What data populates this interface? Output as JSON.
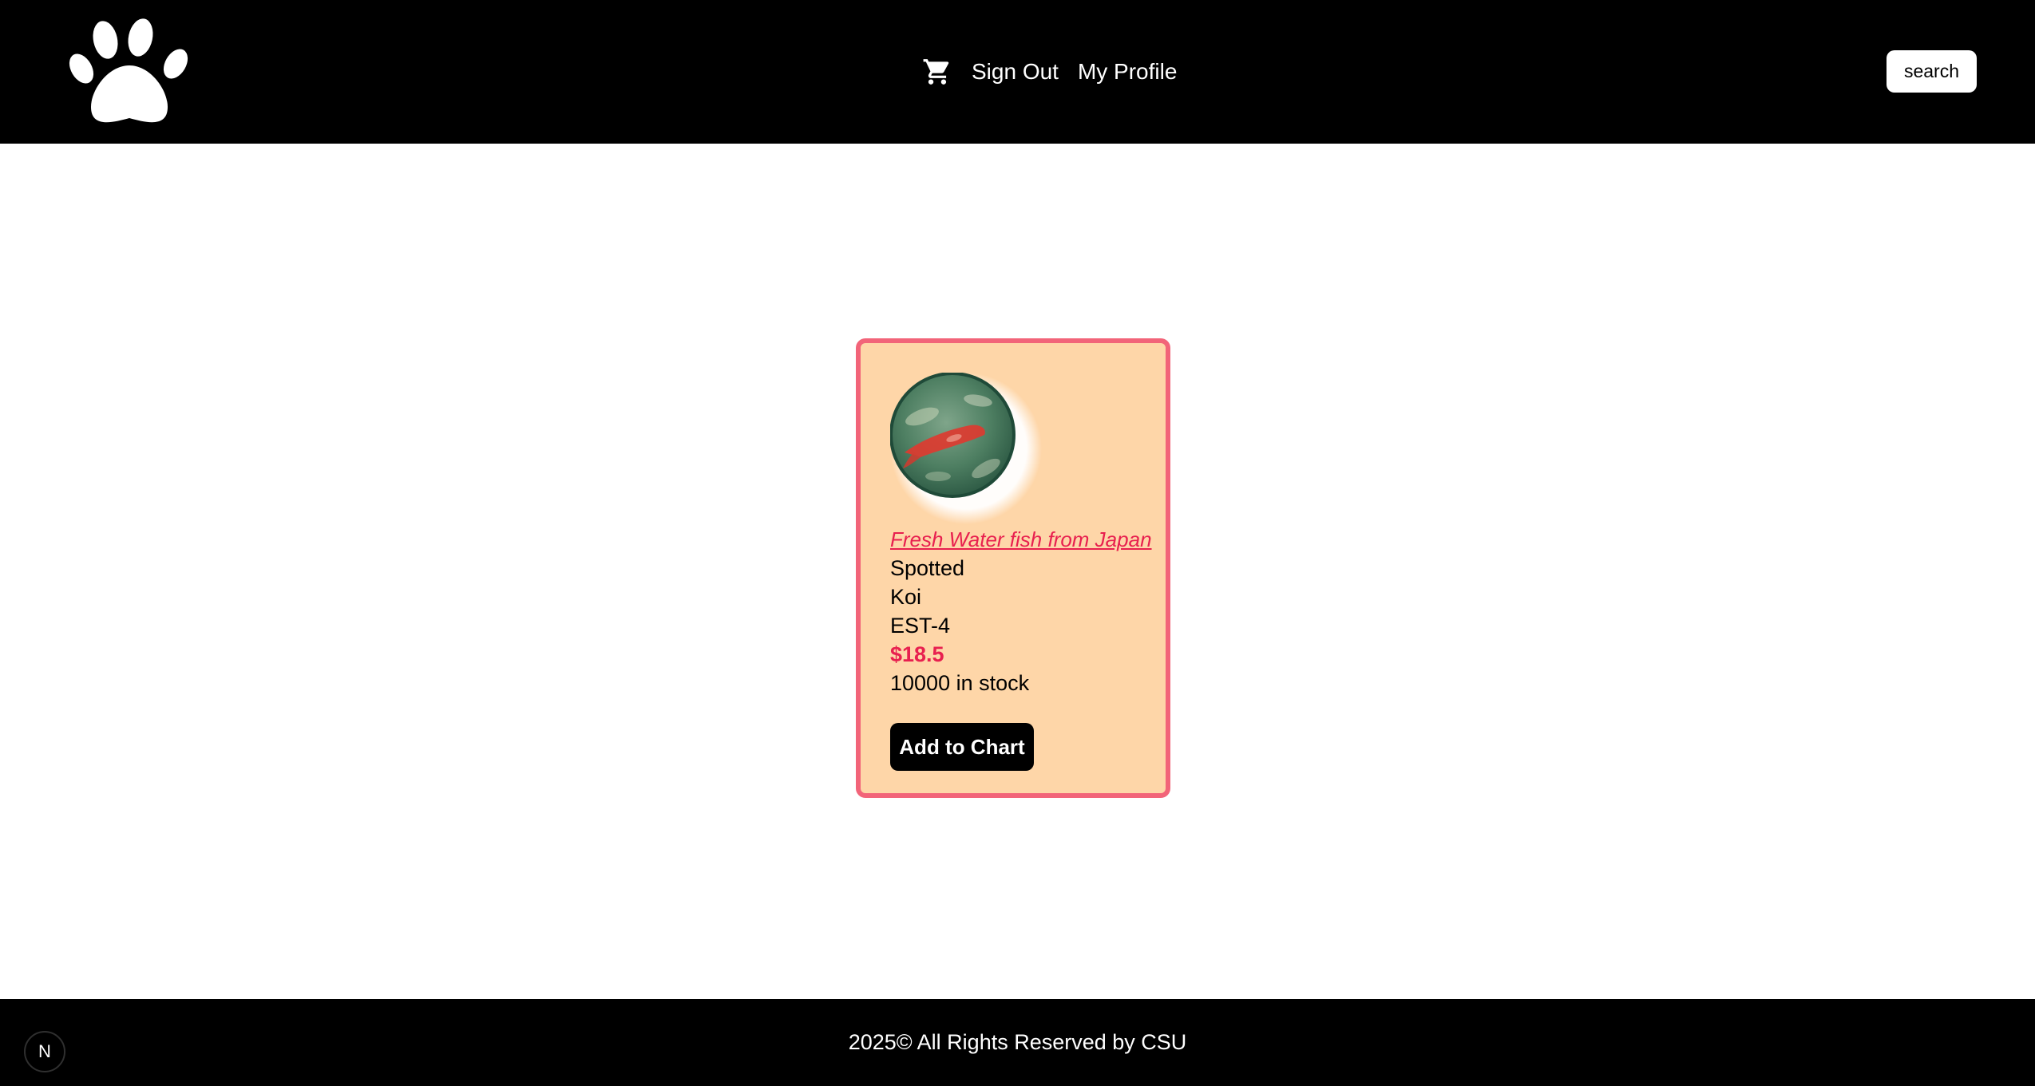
{
  "header": {
    "nav": {
      "sign_out": "Sign Out",
      "my_profile": "My Profile"
    },
    "search_label": "search"
  },
  "icons": {
    "logo": "paw-print-icon",
    "cart": "shopping-cart-icon",
    "dev_badge": "next-js-icon"
  },
  "product": {
    "description": "Fresh Water fish from Japan",
    "attribute": "Spotted",
    "name": "Koi",
    "code": "EST-4",
    "price": "$18.5",
    "stock": "10000 in stock",
    "add_button": "Add to Chart"
  },
  "footer": {
    "text": "2025© All Rights Reserved by CSU"
  },
  "dev_badge_label": "N",
  "colors": {
    "header_bg": "#000000",
    "card_bg": "#fed6a8",
    "card_border": "#f26479",
    "accent": "#e8204f"
  }
}
